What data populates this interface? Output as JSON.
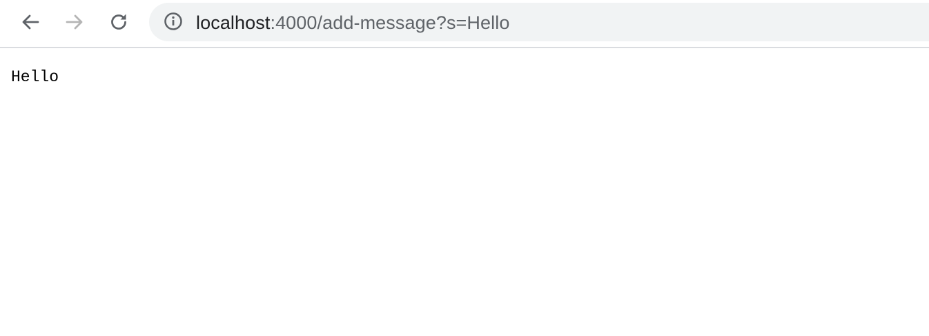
{
  "browser": {
    "nav": {
      "back_icon": "arrow-left-icon",
      "forward_icon": "arrow-right-icon",
      "reload_icon": "reload-icon",
      "icon_color": "#5f6368",
      "disabled_icon_color": "#b5b5b5"
    },
    "address_bar": {
      "info_icon": "info-icon",
      "url_host": "localhost",
      "url_rest": ":4000/add-message?s=Hello",
      "background": "#f1f3f4"
    }
  },
  "page": {
    "message": "Hello"
  }
}
